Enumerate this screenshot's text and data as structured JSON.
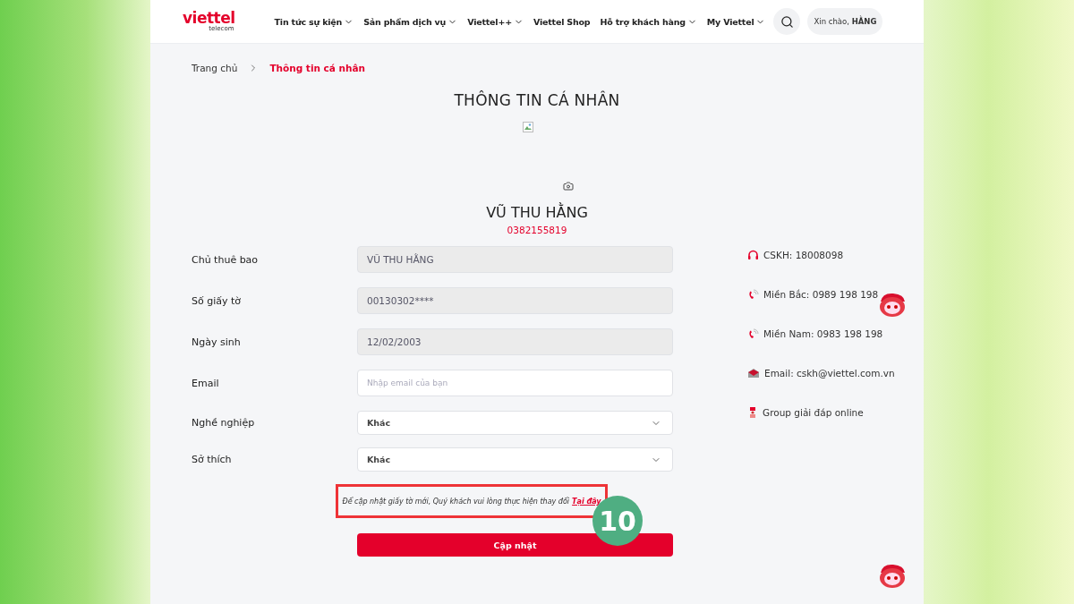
{
  "header": {
    "logo": {
      "brand": "viettel",
      "sub": "telecom"
    },
    "nav": [
      {
        "label": "Tin tức sự kiện",
        "dropdown": true
      },
      {
        "label": "Sản phẩm dịch vụ",
        "dropdown": true
      },
      {
        "label": "Viettel++",
        "dropdown": true
      },
      {
        "label": "Viettel Shop",
        "dropdown": false
      },
      {
        "label": "Hỗ trợ khách hàng",
        "dropdown": true
      },
      {
        "label": "My Viettel",
        "dropdown": true
      }
    ],
    "greeting": "Xin chào, **HẰNG**"
  },
  "breadcrumb": [
    {
      "label": "Trang chủ",
      "selected": false
    },
    {
      "label": "Thông tin cá nhân",
      "selected": true
    }
  ],
  "title": "THÔNG TIN CÁ NHÂN",
  "profile": {
    "name": "VŨ THU HẰNG",
    "phone": "0382155819"
  },
  "fields": [
    {
      "label": "Chủ thuê bao",
      "kind": "readonly",
      "value": "VŨ THU HẰNG"
    },
    {
      "label": "Số giấy tờ",
      "kind": "readonly",
      "value": "00130302****"
    },
    {
      "label": "Ngày sinh",
      "kind": "readonly",
      "value": "12/02/2003"
    },
    {
      "label": "Email",
      "kind": "input",
      "placeholder": "Nhập email của bạn"
    },
    {
      "label": "Nghề nghiệp",
      "kind": "select",
      "value": "Khác"
    },
    {
      "label": "Sở thích",
      "kind": "select",
      "value": "Khác"
    }
  ],
  "note": {
    "text": "Để cập nhật giấy tờ mới, Quý khách vui lòng thực hiện thay đổi",
    "link": "Tại đây"
  },
  "step_badge": "10",
  "submit": "Cập nhật",
  "contacts": [
    {
      "kind": "headset",
      "text": "CSKH: 18008098"
    },
    {
      "kind": "phone",
      "text": "Miền Bắc: 0989 198 198"
    },
    {
      "kind": "phone",
      "text": "Miền Nam: 0983 198 198"
    },
    {
      "kind": "mail",
      "text": "Email: cskh@viettel.com.vn"
    },
    {
      "kind": "group",
      "text": "Group giải đáp online"
    }
  ]
}
